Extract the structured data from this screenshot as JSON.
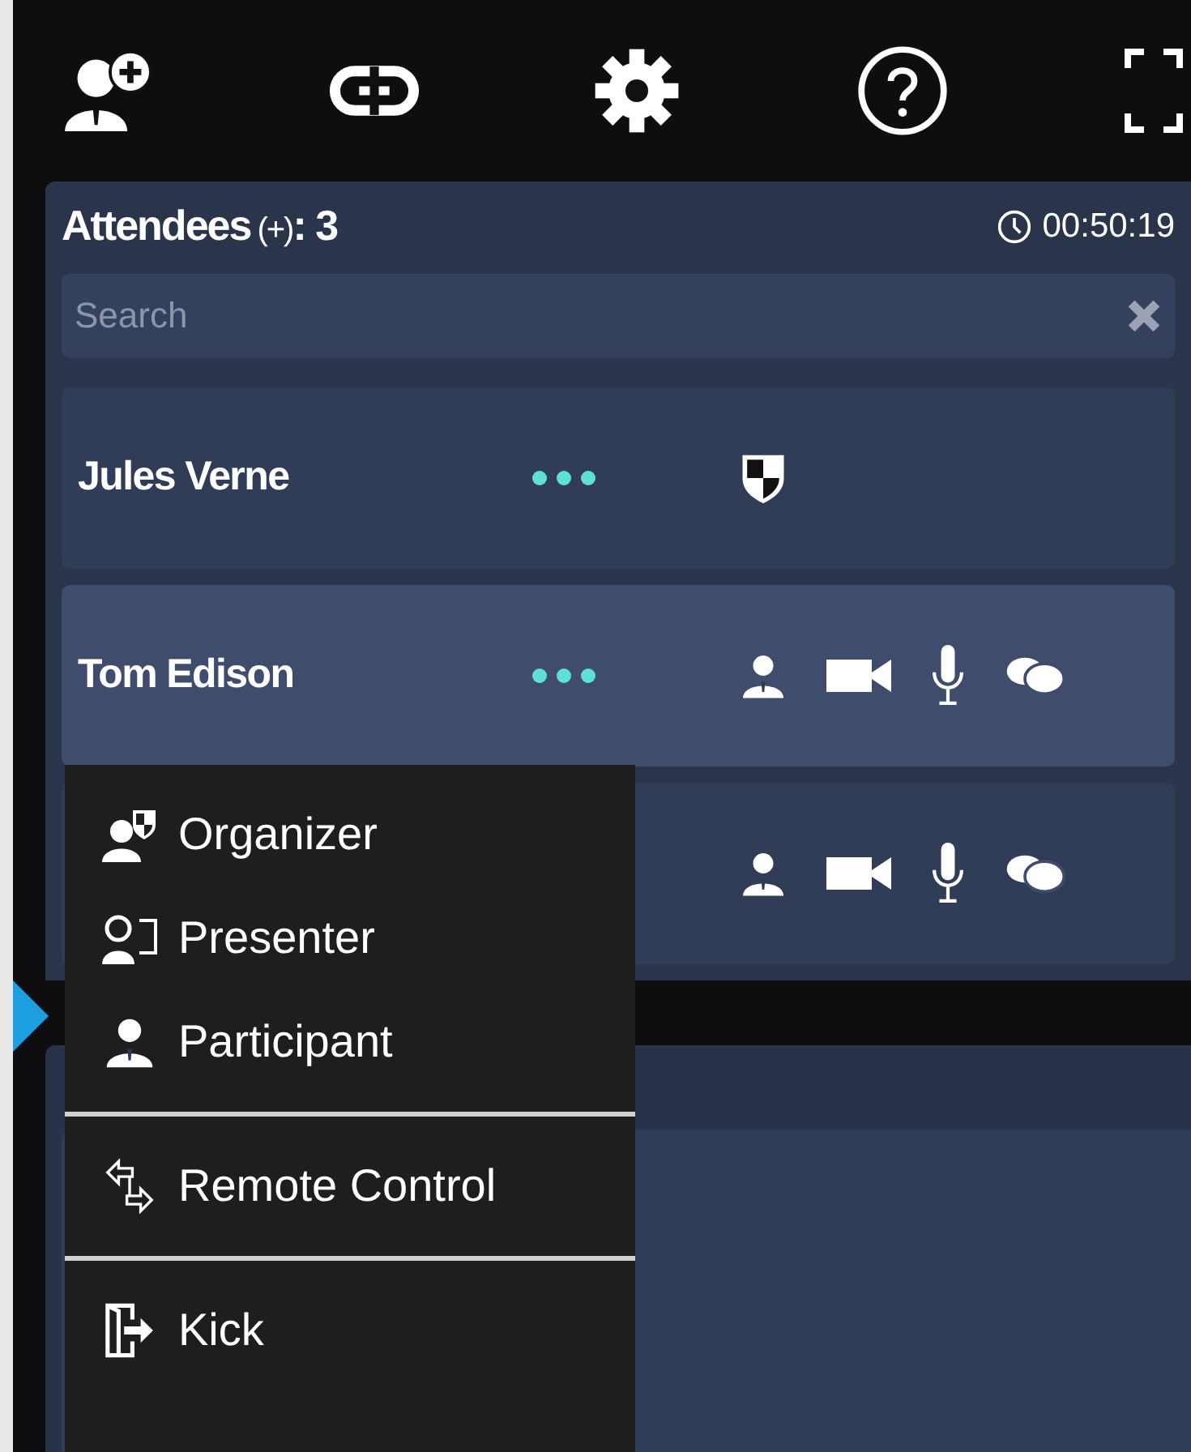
{
  "toolbar": [
    {
      "kind": "add-user"
    },
    {
      "kind": "link"
    },
    {
      "kind": "settings"
    },
    {
      "kind": "help"
    },
    {
      "kind": "fullscreen"
    }
  ],
  "attendees_panel": {
    "title": "Attendees",
    "suffix": "(+)",
    "count": ": 3",
    "timer": "00:50:19",
    "search": {
      "placeholder": "Search"
    }
  },
  "attendees": [
    {
      "name": "Jules Verne",
      "kind": "organizer",
      "selected": false
    },
    {
      "name": "Tom Edison",
      "kind": "participant",
      "selected": true
    },
    {
      "kind": "participant",
      "selected": false
    }
  ],
  "menu": {
    "groups": [
      [
        {
          "label": "Organizer",
          "kind": "organizer"
        },
        {
          "label": "Presenter",
          "kind": "presenter"
        },
        {
          "label": "Participant",
          "kind": "participant"
        }
      ],
      [
        {
          "label": "Remote Control",
          "kind": "remote"
        }
      ],
      [
        {
          "label": "Kick",
          "kind": "kick"
        }
      ]
    ]
  }
}
